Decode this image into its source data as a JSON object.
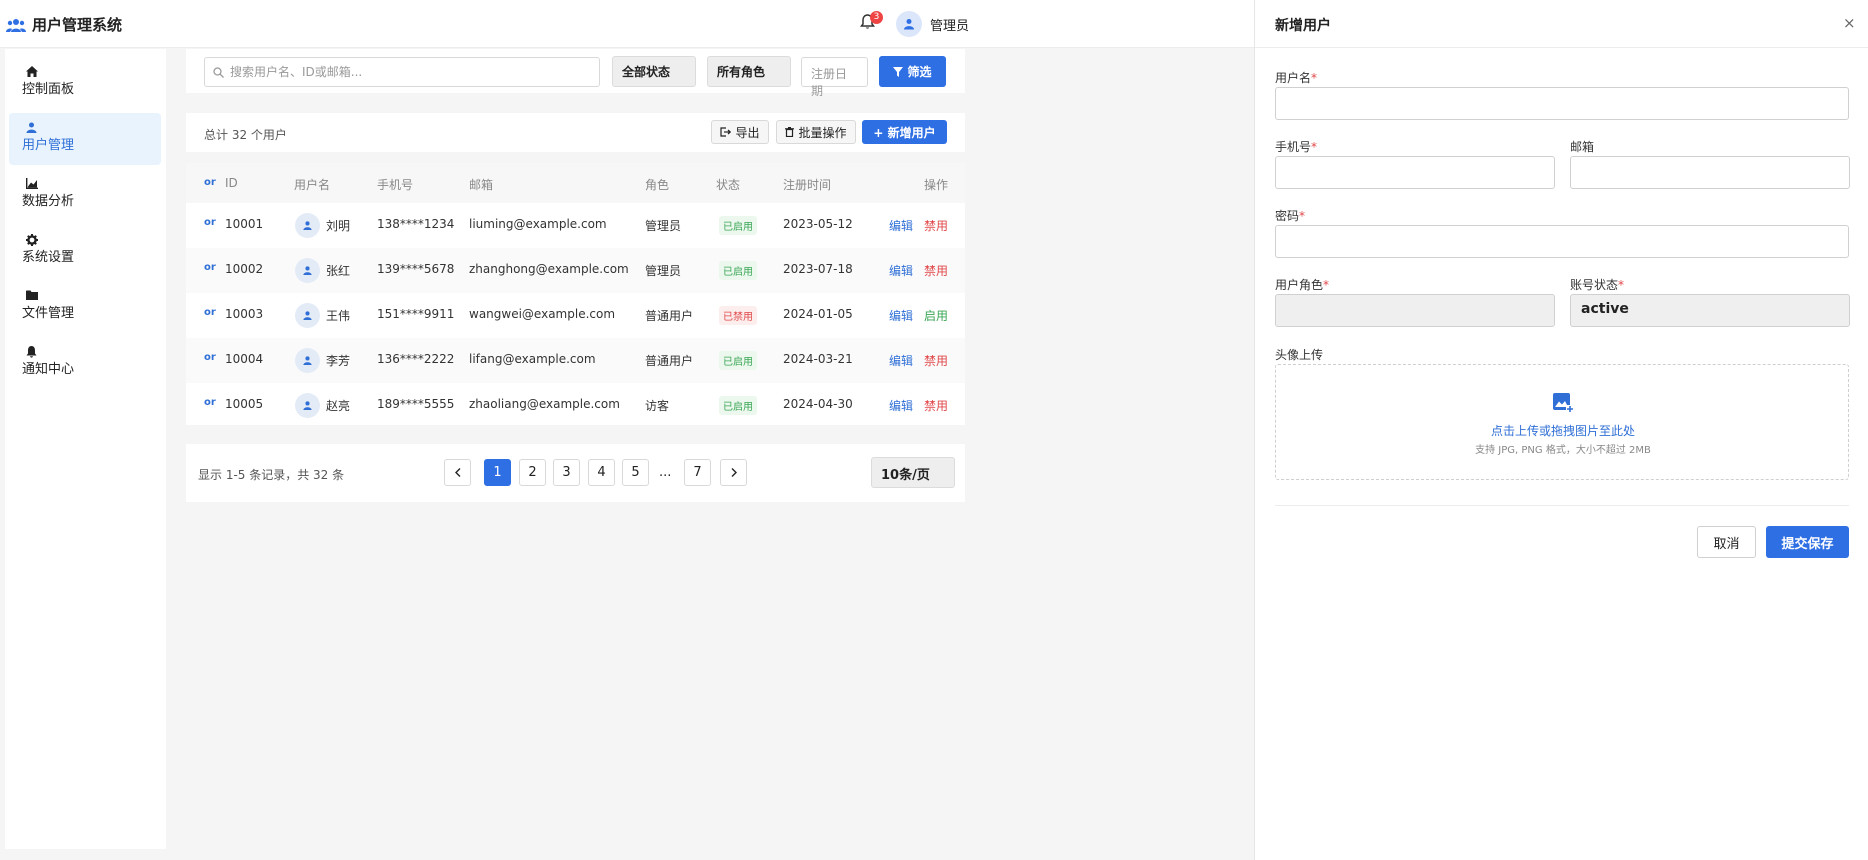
{
  "header": {
    "app_title": "用户管理系统",
    "notification_count": "3",
    "admin_name": "管理员"
  },
  "sidebar": {
    "items": [
      {
        "label": "控制面板",
        "icon": "home-icon"
      },
      {
        "label": "用户管理",
        "icon": "user-icon",
        "active": true
      },
      {
        "label": "数据分析",
        "icon": "chart-icon"
      },
      {
        "label": "系统设置",
        "icon": "gear-icon"
      },
      {
        "label": "文件管理",
        "icon": "folder-icon"
      },
      {
        "label": "通知中心",
        "icon": "bell-icon"
      }
    ]
  },
  "filter": {
    "search_placeholder": "搜索用户名、ID或邮箱...",
    "status_select": "全部状态",
    "role_select": "所有角色",
    "date_placeholder": "注册日期",
    "filter_button": "筛选"
  },
  "toolbar": {
    "total_text": "总计 32 个用户",
    "export_label": "导出",
    "batch_label": "批量操作",
    "add_user_label": "+ 新增用户"
  },
  "table": {
    "sort_label": "or",
    "headers": {
      "id": "ID",
      "username": "用户名",
      "phone": "手机号",
      "email": "邮箱",
      "role": "角色",
      "status": "状态",
      "registered": "注册时间",
      "actions": "操作"
    },
    "rows": [
      {
        "id": "10001",
        "name": "刘明",
        "phone": "138****1234",
        "email": "liuming@example.com",
        "role": "管理员",
        "status": "已启用",
        "date": "2023-05-12",
        "edit": "编辑",
        "action": "禁用"
      },
      {
        "id": "10002",
        "name": "张红",
        "phone": "139****5678",
        "email": "zhanghong@example.com",
        "role": "管理员",
        "status": "已启用",
        "date": "2023-07-18",
        "edit": "编辑",
        "action": "禁用"
      },
      {
        "id": "10003",
        "name": "王伟",
        "phone": "151****9911",
        "email": "wangwei@example.com",
        "role": "普通用户",
        "status": "已禁用",
        "date": "2024-01-05",
        "edit": "编辑",
        "action": "启用"
      },
      {
        "id": "10004",
        "name": "李芳",
        "phone": "136****2222",
        "email": "lifang@example.com",
        "role": "普通用户",
        "status": "已启用",
        "date": "2024-03-21",
        "edit": "编辑",
        "action": "禁用"
      },
      {
        "id": "10005",
        "name": "赵亮",
        "phone": "189****5555",
        "email": "zhaoliang@example.com",
        "role": "访客",
        "status": "已启用",
        "date": "2024-04-30",
        "edit": "编辑",
        "action": "禁用"
      }
    ]
  },
  "pagination": {
    "info": "显示 1-5 条记录，共 32 条",
    "pages": [
      "1",
      "2",
      "3",
      "4",
      "5"
    ],
    "ellipsis": "...",
    "last_page": "7",
    "current_page": "1",
    "per_page": "10条/页"
  },
  "drawer": {
    "title": "新增用户",
    "close": "×",
    "username_label": "用户名",
    "phone_label": "手机号",
    "email_label": "邮箱",
    "password_label": "密码",
    "role_label": "用户角色",
    "status_label": "账号状态",
    "status_value": "active",
    "required_mark": "*",
    "avatar_label": "头像上传",
    "upload_text": "点击上传或拖拽图片至此处",
    "upload_hint": "支持 JPG, PNG 格式，大小不超过 2MB",
    "cancel_label": "取消",
    "submit_label": "提交保存"
  },
  "colors": {
    "primary": "#2f6fe4",
    "success": "#3aa655",
    "danger": "#e0484a",
    "active_nav_bg": "#e8f3fd"
  }
}
